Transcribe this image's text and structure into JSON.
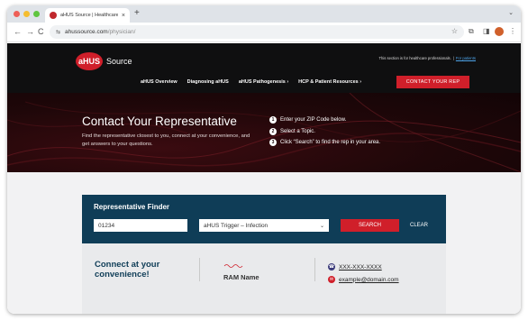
{
  "browser": {
    "tab_title": "aHUS Source | Healthcare Pr",
    "tab_close": "×",
    "new_tab": "+",
    "tab_search": "⌄",
    "url_host": "ahussource.com",
    "url_path": "/physician/",
    "back": "←",
    "forward": "→",
    "reload": "C",
    "site_info": "⇆",
    "star": "☆",
    "extensions": "⧉",
    "sidebar": "◨",
    "menu": "⋮"
  },
  "header": {
    "logo_mark": "aHUS",
    "logo_text": "Source",
    "hcp_notice": "This section is for healthcare professionals.",
    "hcp_sep": "|",
    "patient_link": "For patients",
    "nav": [
      "aHUS Overview",
      "Diagnosing aHUS",
      "aHUS Pathogenesis ›",
      "HCP & Patient Resources ›"
    ],
    "cta": "CONTACT YOUR REP"
  },
  "hero": {
    "title": "Contact Your Representative",
    "subtitle": "Find the representative closest to you, connect at your convenience, and get answers to your questions.",
    "steps": [
      {
        "num": "1",
        "text": "Enter your ZIP Code below."
      },
      {
        "num": "2",
        "text": "Select a Topic."
      },
      {
        "num": "3",
        "text": "Click “Search” to find the rep in your area."
      }
    ]
  },
  "finder": {
    "title": "Representative Finder",
    "zip_value": "01234",
    "topic_value": "aHUS Trigger – Infection",
    "chevron": "⌄",
    "search_label": "SEARCH",
    "clear_label": "CLEAR"
  },
  "result": {
    "heading": "Connect at your convenience!",
    "ram_name": "RAM Name",
    "phone": "XXX-XXX-XXXX",
    "email": "example@domain.com"
  },
  "colors": {
    "brand_red": "#d01f2a",
    "finder_navy": "#0f3d57",
    "header_black": "#0f0f10"
  }
}
